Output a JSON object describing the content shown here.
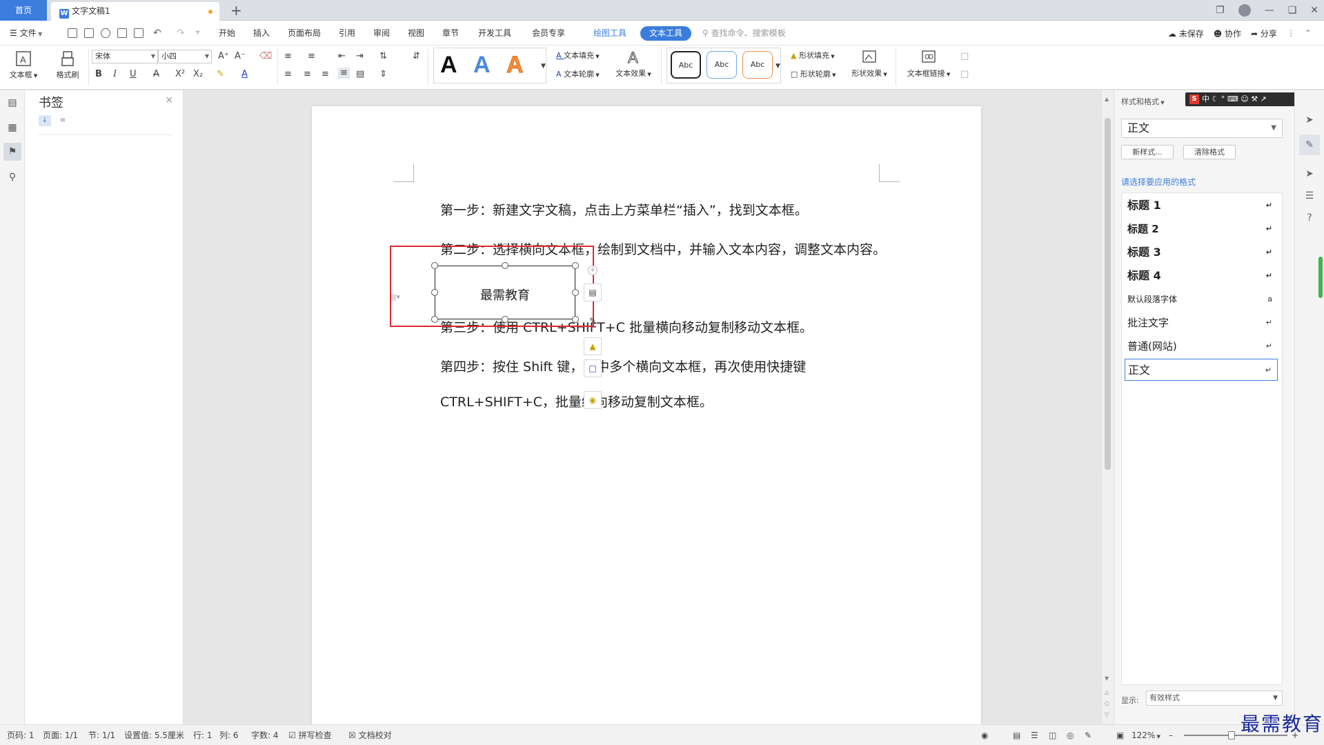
{
  "titlebar": {
    "home_tab": "首页",
    "doc_tab": "文字文稿1",
    "doc_icon": "W",
    "add_tab": "+",
    "window_buttons": [
      "❐",
      "—",
      "❑",
      "✕"
    ]
  },
  "menubar": {
    "file_menu": "文件",
    "tabs": [
      "开始",
      "插入",
      "页面布局",
      "引用",
      "审阅",
      "视图",
      "章节",
      "开发工具",
      "会员专享"
    ],
    "drawing_tools": "绘图工具",
    "text_tools": "文本工具",
    "search_placeholder": "查找命令、搜索模板",
    "unsaved": "未保存",
    "collaborate": "协作",
    "share": "分享"
  },
  "ribbon": {
    "textbox_btn": "文本框",
    "format_painter_btn": "格式刷",
    "font_name": "宋体",
    "font_size": "小四",
    "text_fill": "文本填充",
    "text_outline": "文本轮廓",
    "text_effects": "文本效果",
    "style_letter": "A",
    "shape_style_label": "Abc",
    "shape_fill": "形状填充",
    "shape_outline": "形状轮廓",
    "shape_effects": "形状效果",
    "textbox_link": "文本框链接"
  },
  "bookmark_pane": {
    "title": "书签",
    "close": "×"
  },
  "document": {
    "paragraphs": [
      "第一步：新建文字文稿，点击上方菜单栏“插入”，找到文本框。",
      "第二步：选择横向文本框，绘制到文档中，并输入文本内容，调整文本内容。",
      "第三步：使用 CTRL+SHIFT+C 批量横向移动复制移动文本框。",
      "第四步：按住 Shift 键，选中多个横向文本框，再次使用快捷键",
      "CTRL+SHIFT+C，批量纵向移动复制文本框。"
    ],
    "textbox_text": "最需教育"
  },
  "styles_panel": {
    "header": "样式和格式",
    "current_style": "正文",
    "new_style_btn": "新样式...",
    "clear_format_btn": "清除格式",
    "apply_label": "请选择要应用的格式",
    "styles": [
      "标题  1",
      "标题  2",
      "标题  3",
      "标题  4",
      "默认段落字体",
      "批注文字",
      "普通(网站)",
      "正文"
    ],
    "show_label": "显示:",
    "show_value": "有效样式"
  },
  "ime_bar": {
    "logo": "S",
    "mode": "中"
  },
  "statusbar": {
    "page": "页码: 1",
    "pages": "页面: 1/1",
    "section": "节: 1/1",
    "setting": "设置值: 5.5厘米",
    "row": "行: 1",
    "col": "列: 6",
    "words": "字数: 4",
    "spell_check": "拼写检查",
    "doc_proof": "文档校对",
    "zoom": "122%"
  },
  "watermark": "最需教育",
  "colors": {
    "accent": "#3b7ddd",
    "highlight": "#e0282e"
  }
}
